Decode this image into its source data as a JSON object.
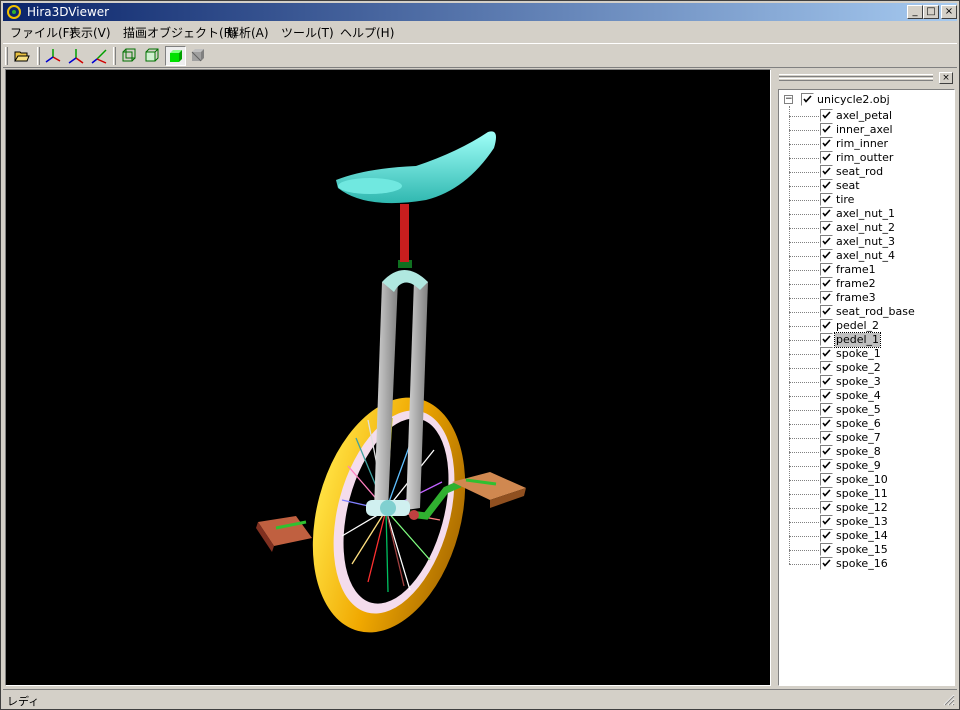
{
  "window": {
    "title": "Hira3DViewer"
  },
  "window_controls": {
    "minimize": "_",
    "maximize": "□",
    "close": "×"
  },
  "menu": [
    {
      "label": "ファイル(F)"
    },
    {
      "label": "表示(V)"
    },
    {
      "label": "描画オブジェクト(R)"
    },
    {
      "label": "解析(A)"
    },
    {
      "label": "ツール(T)"
    },
    {
      "label": "ヘルプ(H)"
    }
  ],
  "toolbar": {
    "buttons": [
      "open-folder",
      "axis-xyz",
      "axis-xy",
      "axis-xz",
      "wireframe",
      "hidden-line",
      "solid-shaded",
      "textured"
    ],
    "pressed": "solid-shaded"
  },
  "panel": {
    "close": "×"
  },
  "tree": {
    "root": {
      "expander": "−",
      "label": "unicycle2.obj",
      "checked": true
    },
    "children": [
      {
        "label": "axel_petal",
        "checked": true
      },
      {
        "label": "inner_axel",
        "checked": true
      },
      {
        "label": "rim_inner",
        "checked": true
      },
      {
        "label": "rim_outter",
        "checked": true
      },
      {
        "label": "seat_rod",
        "checked": true
      },
      {
        "label": "seat",
        "checked": true
      },
      {
        "label": "tire",
        "checked": true
      },
      {
        "label": "axel_nut_1",
        "checked": true
      },
      {
        "label": "axel_nut_2",
        "checked": true
      },
      {
        "label": "axel_nut_3",
        "checked": true
      },
      {
        "label": "axel_nut_4",
        "checked": true
      },
      {
        "label": "frame1",
        "checked": true
      },
      {
        "label": "frame2",
        "checked": true
      },
      {
        "label": "frame3",
        "checked": true
      },
      {
        "label": "seat_rod_base",
        "checked": true
      },
      {
        "label": "pedel_2",
        "checked": true
      },
      {
        "label": "pedel_1",
        "checked": true,
        "selected": true
      },
      {
        "label": "spoke_1",
        "checked": true
      },
      {
        "label": "spoke_2",
        "checked": true
      },
      {
        "label": "spoke_3",
        "checked": true
      },
      {
        "label": "spoke_4",
        "checked": true
      },
      {
        "label": "spoke_5",
        "checked": true
      },
      {
        "label": "spoke_6",
        "checked": true
      },
      {
        "label": "spoke_7",
        "checked": true
      },
      {
        "label": "spoke_8",
        "checked": true
      },
      {
        "label": "spoke_9",
        "checked": true
      },
      {
        "label": "spoke_10",
        "checked": true
      },
      {
        "label": "spoke_11",
        "checked": true
      },
      {
        "label": "spoke_12",
        "checked": true
      },
      {
        "label": "spoke_13",
        "checked": true
      },
      {
        "label": "spoke_14",
        "checked": true
      },
      {
        "label": "spoke_15",
        "checked": true
      },
      {
        "label": "spoke_16",
        "checked": true
      }
    ]
  },
  "status": {
    "text": "レディ"
  },
  "colors": {
    "title_start": "#0a246a",
    "title_end": "#a6caf0",
    "viewport_bg": "#000000",
    "seat": "#5fe8e0",
    "seat_rod": "#c81e1e",
    "frame": "#a8a8a8",
    "tire": "#f0a800",
    "rim": "#f0d0e8",
    "crank": "#30b030",
    "pedal": "#c87848"
  }
}
